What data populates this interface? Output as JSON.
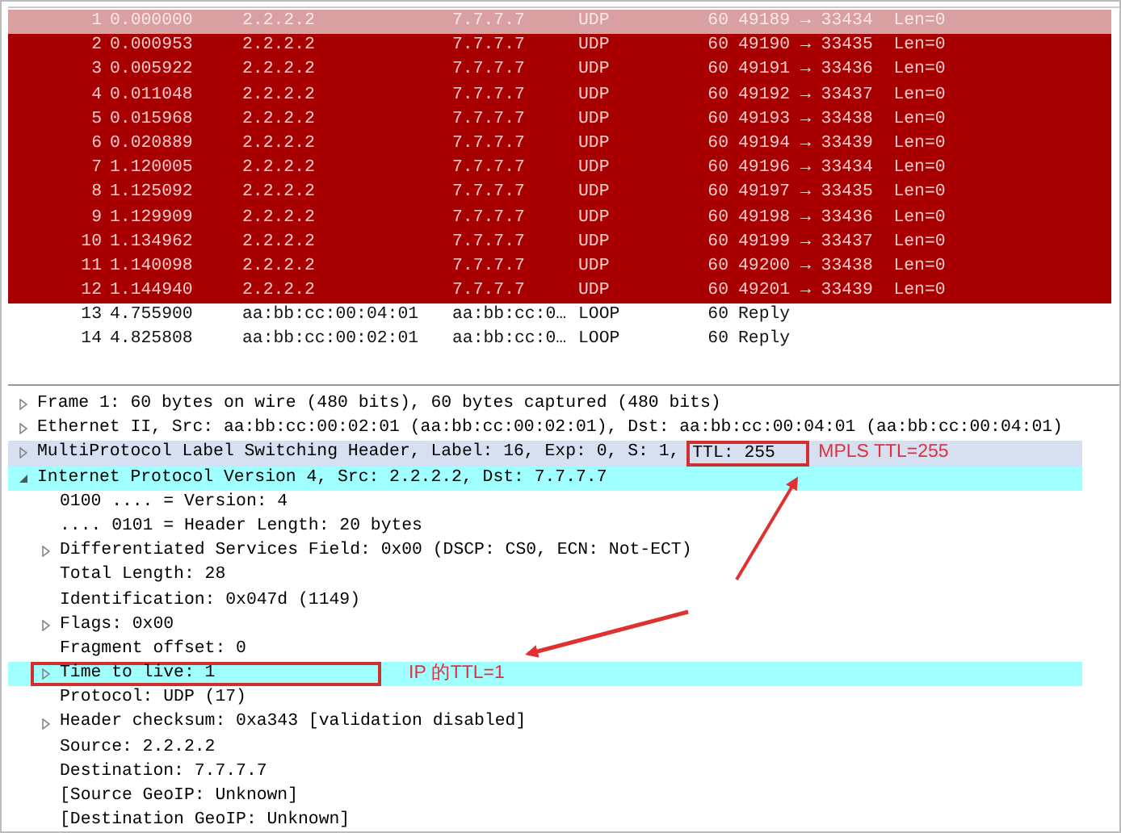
{
  "packet_list": {
    "rows": [
      {
        "no": "1",
        "time": "0.000000",
        "source": "2.2.2.2",
        "destination": "7.7.7.7",
        "protocol": "UDP",
        "length": "60",
        "info": "49189 → 33434  Len=0",
        "kind": "error",
        "selected": true
      },
      {
        "no": "2",
        "time": "0.000953",
        "source": "2.2.2.2",
        "destination": "7.7.7.7",
        "protocol": "UDP",
        "length": "60",
        "info": "49190 → 33435  Len=0",
        "kind": "error",
        "selected": false
      },
      {
        "no": "3",
        "time": "0.005922",
        "source": "2.2.2.2",
        "destination": "7.7.7.7",
        "protocol": "UDP",
        "length": "60",
        "info": "49191 → 33436  Len=0",
        "kind": "error",
        "selected": false
      },
      {
        "no": "4",
        "time": "0.011048",
        "source": "2.2.2.2",
        "destination": "7.7.7.7",
        "protocol": "UDP",
        "length": "60",
        "info": "49192 → 33437  Len=0",
        "kind": "error",
        "selected": false
      },
      {
        "no": "5",
        "time": "0.015968",
        "source": "2.2.2.2",
        "destination": "7.7.7.7",
        "protocol": "UDP",
        "length": "60",
        "info": "49193 → 33438  Len=0",
        "kind": "error",
        "selected": false
      },
      {
        "no": "6",
        "time": "0.020889",
        "source": "2.2.2.2",
        "destination": "7.7.7.7",
        "protocol": "UDP",
        "length": "60",
        "info": "49194 → 33439  Len=0",
        "kind": "error",
        "selected": false
      },
      {
        "no": "7",
        "time": "1.120005",
        "source": "2.2.2.2",
        "destination": "7.7.7.7",
        "protocol": "UDP",
        "length": "60",
        "info": "49196 → 33434  Len=0",
        "kind": "error",
        "selected": false
      },
      {
        "no": "8",
        "time": "1.125092",
        "source": "2.2.2.2",
        "destination": "7.7.7.7",
        "protocol": "UDP",
        "length": "60",
        "info": "49197 → 33435  Len=0",
        "kind": "error",
        "selected": false
      },
      {
        "no": "9",
        "time": "1.129909",
        "source": "2.2.2.2",
        "destination": "7.7.7.7",
        "protocol": "UDP",
        "length": "60",
        "info": "49198 → 33436  Len=0",
        "kind": "error",
        "selected": false
      },
      {
        "no": "10",
        "time": "1.134962",
        "source": "2.2.2.2",
        "destination": "7.7.7.7",
        "protocol": "UDP",
        "length": "60",
        "info": "49199 → 33437  Len=0",
        "kind": "error",
        "selected": false
      },
      {
        "no": "11",
        "time": "1.140098",
        "source": "2.2.2.2",
        "destination": "7.7.7.7",
        "protocol": "UDP",
        "length": "60",
        "info": "49200 → 33438  Len=0",
        "kind": "error",
        "selected": false
      },
      {
        "no": "12",
        "time": "1.144940",
        "source": "2.2.2.2",
        "destination": "7.7.7.7",
        "protocol": "UDP",
        "length": "60",
        "info": "49201 → 33439  Len=0",
        "kind": "error",
        "selected": false
      },
      {
        "no": "13",
        "time": "4.755900",
        "source": "aa:bb:cc:00:04:01",
        "destination": "aa:bb:cc:0…",
        "protocol": "LOOP",
        "length": "60",
        "info": "Reply",
        "kind": "normal",
        "selected": false
      },
      {
        "no": "14",
        "time": "4.825808",
        "source": "aa:bb:cc:00:02:01",
        "destination": "aa:bb:cc:0…",
        "protocol": "LOOP",
        "length": "60",
        "info": "Reply",
        "kind": "normal",
        "selected": false
      }
    ]
  },
  "details": {
    "items": [
      {
        "text": "Frame 1: 60 bytes on wire (480 bits), 60 bytes captured (480 bits)",
        "kind": "node",
        "expanded": false,
        "selected": false,
        "highlighted": false
      },
      {
        "text": "Ethernet II, Src: aa:bb:cc:00:02:01 (aa:bb:cc:00:02:01), Dst: aa:bb:cc:00:04:01 (aa:bb:cc:00:04:01)",
        "kind": "node",
        "expanded": false,
        "selected": false,
        "highlighted": false
      },
      {
        "text": "MultiProtocol Label Switching Header, Label: 16, Exp: 0, S: 1,",
        "boxed": "TTL: 255",
        "annotation": "MPLS TTL=255",
        "kind": "node",
        "expanded": false,
        "selected": true,
        "highlighted": false
      },
      {
        "text": "Internet Protocol Version 4, Src: 2.2.2.2, Dst: 7.7.7.7",
        "kind": "node",
        "expanded": true,
        "selected": false,
        "highlighted": true,
        "children": [
          {
            "text": "0100 .... = Version: 4",
            "kind": "leaf",
            "selected": false,
            "highlighted": false
          },
          {
            "text": ".... 0101 = Header Length: 20 bytes",
            "kind": "leaf",
            "selected": false,
            "highlighted": false
          },
          {
            "text": "Differentiated Services Field: 0x00 (DSCP: CS0, ECN: Not-ECT)",
            "kind": "node",
            "expanded": false,
            "selected": false,
            "highlighted": false
          },
          {
            "text": "Total Length: 28",
            "kind": "leaf",
            "selected": false,
            "highlighted": false
          },
          {
            "text": "Identification: 0x047d (1149)",
            "kind": "leaf",
            "selected": false,
            "highlighted": false
          },
          {
            "text": "Flags: 0x00",
            "kind": "node",
            "expanded": false,
            "selected": false,
            "highlighted": false
          },
          {
            "text": "Fragment offset: 0",
            "kind": "leaf",
            "selected": false,
            "highlighted": false
          },
          {
            "text": "Time to live: 1",
            "boxed_row": true,
            "annotation": "IP 的TTL=1",
            "kind": "node",
            "expanded": false,
            "selected": false,
            "highlighted": true
          },
          {
            "text": "Protocol: UDP (17)",
            "kind": "leaf",
            "selected": false,
            "highlighted": false
          },
          {
            "text": "Header checksum: 0xa343 [validation disabled]",
            "kind": "node",
            "expanded": false,
            "selected": false,
            "highlighted": false
          },
          {
            "text": "Source: 2.2.2.2",
            "kind": "leaf",
            "selected": false,
            "highlighted": false
          },
          {
            "text": "Destination: 7.7.7.7",
            "kind": "leaf",
            "selected": false,
            "highlighted": false
          },
          {
            "text": "[Source GeoIP: Unknown]",
            "kind": "leaf",
            "selected": false,
            "highlighted": false
          },
          {
            "text": "[Destination GeoIP: Unknown]",
            "kind": "leaf",
            "selected": false,
            "highlighted": false
          }
        ]
      }
    ]
  }
}
